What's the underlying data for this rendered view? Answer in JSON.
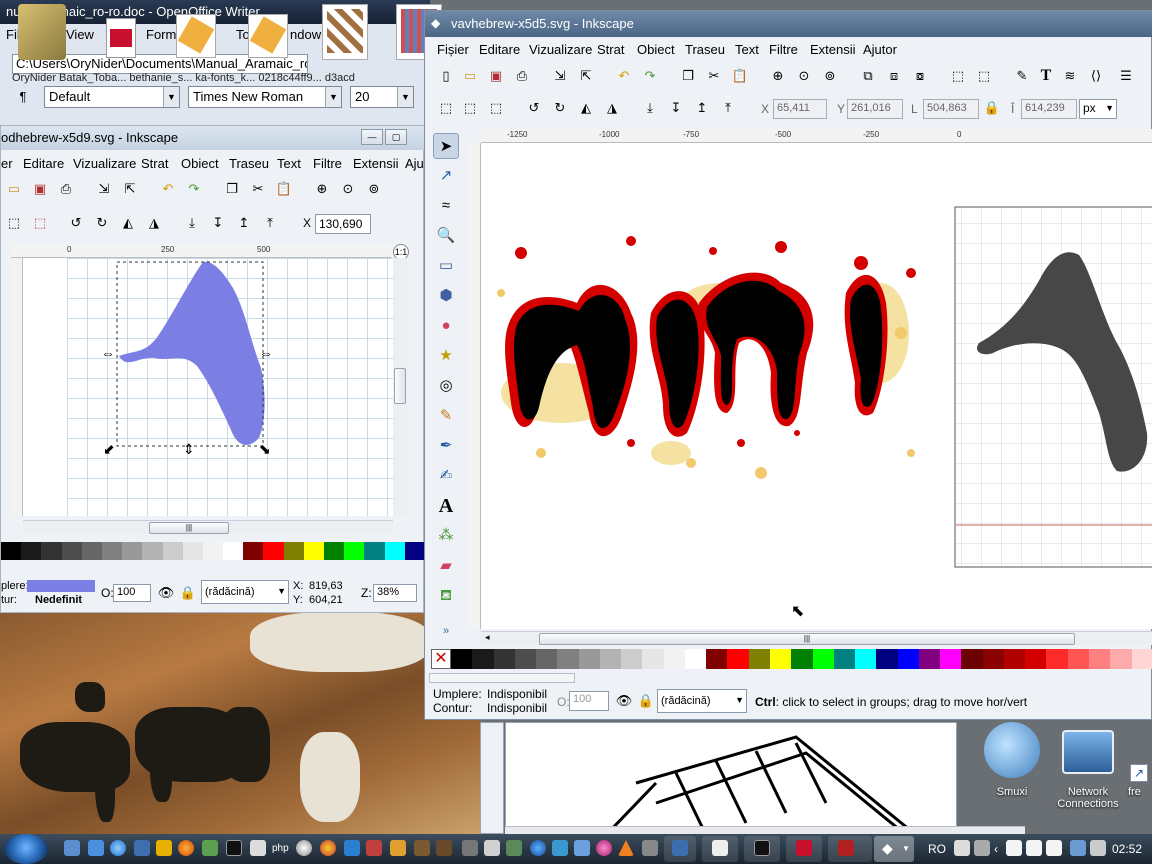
{
  "ooo": {
    "title": "nual_Aramaic_ro-ro.doc - OpenOffice Writer",
    "menu": [
      "File",
      "View",
      "Form",
      "To",
      "ndow"
    ],
    "path": "C:\\Users\\OryNider\\Documents\\Manual_Aramaic_ro-",
    "files": "OryNider   Batak_Toba...   bethanie_s...   ka-fonts_k...   0218c44ff9...   d3acd",
    "style": "Default",
    "font": "Times New Roman",
    "size": "20"
  },
  "ink_left": {
    "title": "odhebrew-x5d9.svg - Inkscape",
    "menu": [
      "er",
      "Editare",
      "Vizualizare",
      "Strat",
      "Obiect",
      "Traseu",
      "Text",
      "Filtre",
      "Extensii",
      "Aju"
    ],
    "x_label": "X",
    "x_value": "130,690",
    "ruler_h": [
      "0",
      "250",
      "500"
    ],
    "fill_label": "plere:",
    "stroke_label": "tur:",
    "stroke_value": "Nedefinit",
    "opacity_label": "O:",
    "opacity_value": "100",
    "layer": "(rădăcină)",
    "coord_x_label": "X:",
    "coord_x": "819,63",
    "coord_y_label": "Y:",
    "coord_y": "604,21",
    "zoom_label": "Z:",
    "zoom": "38%",
    "colors": {
      "shape": "#7b7fe3"
    }
  },
  "ink_right": {
    "title": "vavhebrew-x5d5.svg - Inkscape",
    "menu": [
      "Fișier",
      "Editare",
      "Vizualizare",
      "Strat",
      "Obiect",
      "Traseu",
      "Text",
      "Filtre",
      "Extensii",
      "Ajutor"
    ],
    "x_label": "X",
    "x_value": "65,411",
    "y_label": "Y",
    "y_value": "261,016",
    "w_label": "L",
    "w_value": "504,863",
    "h_label": "Î",
    "h_value": "614,239",
    "unit": "px",
    "ruler_h": [
      "-1250",
      "-1000",
      "-750",
      "-500",
      "-250",
      "0"
    ],
    "fill_label": "Umplere:",
    "fill_value": "Indisponibil",
    "stroke_label": "Contur:",
    "stroke_value": "Indisponibil",
    "opacity_label": "O:",
    "opacity_value": "100",
    "layer": "(rădăcină)",
    "status_bold": "Ctrl",
    "status_text": ": click to select in groups; drag to move hor/vert",
    "colors": {
      "shape": "#474747",
      "ink": "#000000",
      "edge": "#d40000"
    }
  },
  "desktop": {
    "icon1": "Smuxi",
    "icon2": "Network Connections",
    "icon3": "fre"
  },
  "taskbar": {
    "lang": "RO",
    "time": "02:52",
    "php": "php"
  }
}
